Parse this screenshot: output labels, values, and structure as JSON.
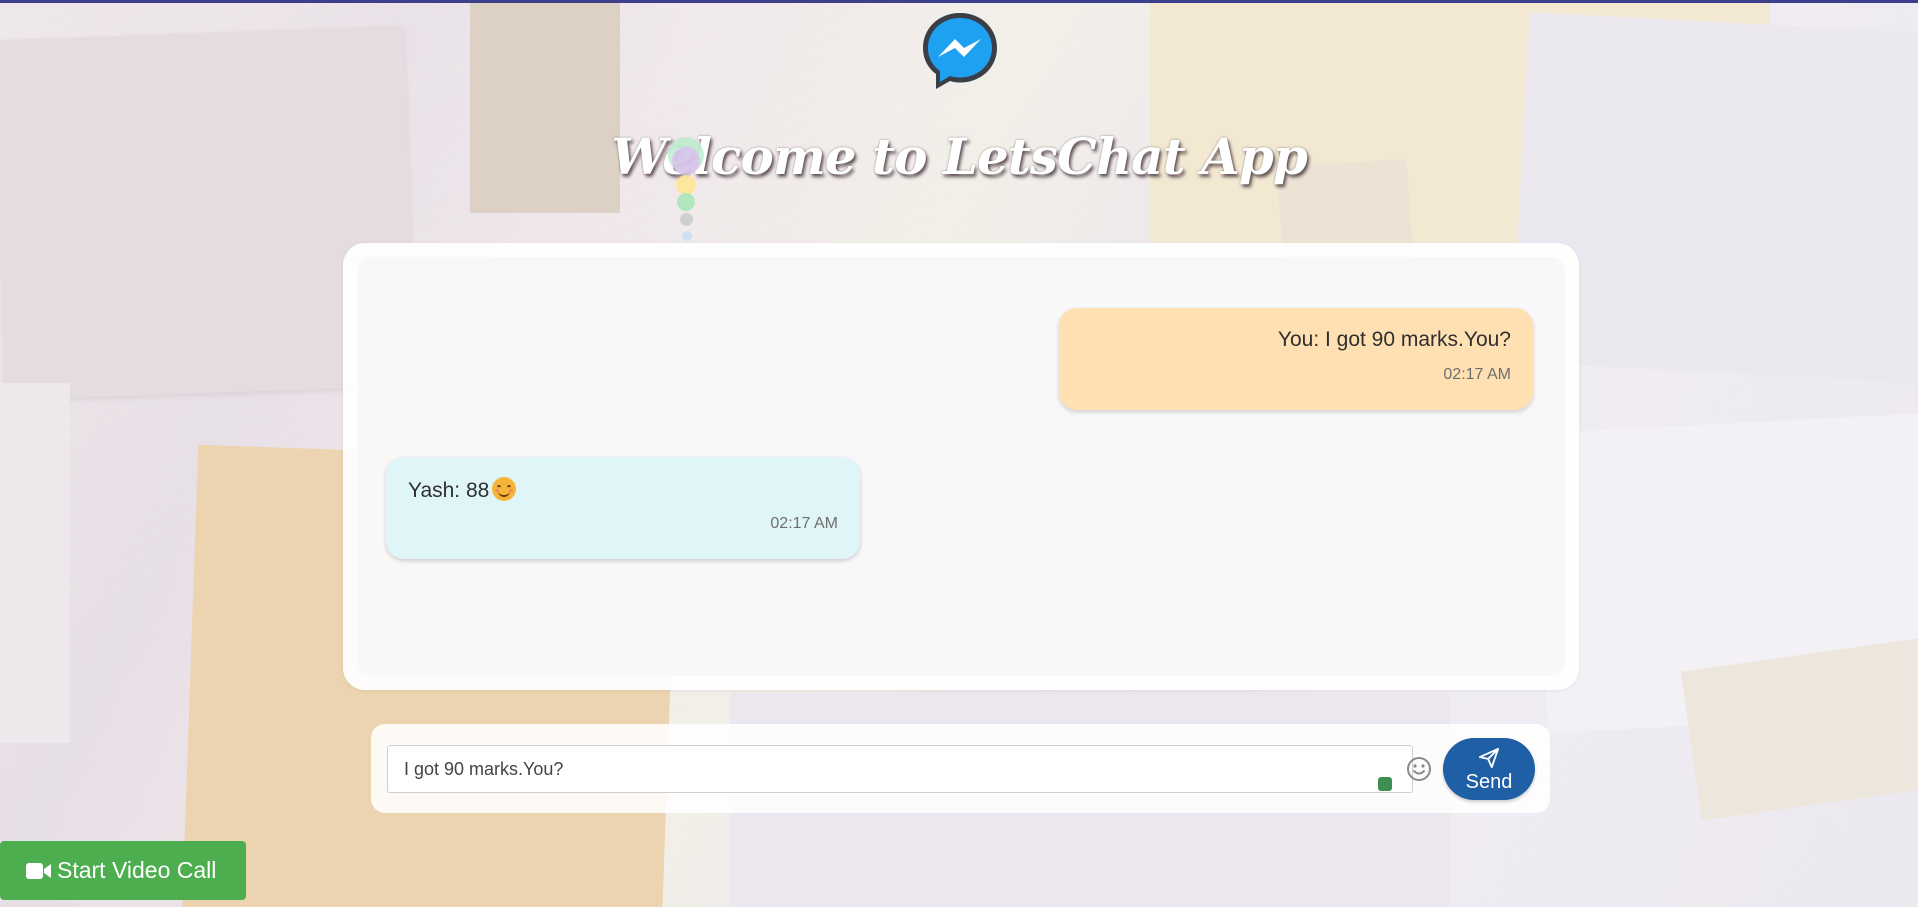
{
  "header": {
    "logo_icon": "messenger-icon",
    "title": "Welcome to LetsChat App"
  },
  "messages": [
    {
      "direction": "outgoing",
      "text": "You: I got 90 marks.You?",
      "time": "02:17 AM",
      "bubble_color": "#ffe0b2"
    },
    {
      "direction": "incoming",
      "text": "Yash: 88",
      "emoji": "smiling-face-icon",
      "time": "02:17 AM",
      "bubble_color": "#dff5f7"
    }
  ],
  "composer": {
    "input_value": "I got 90 marks.You?",
    "emoji_icon": "smiley-icon",
    "send_icon": "paper-plane-icon",
    "send_label": "Send",
    "send_color": "#1f5fa5"
  },
  "video_call": {
    "icon": "video-camera-icon",
    "label": "Start Video Call",
    "color": "#4cae4f"
  }
}
